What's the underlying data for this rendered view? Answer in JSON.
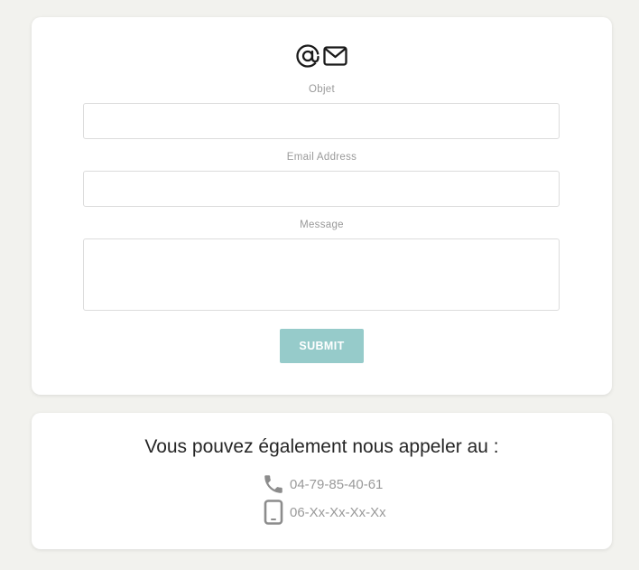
{
  "contact_form": {
    "header_icons": [
      "at-icon",
      "envelope-icon"
    ],
    "subject_label": "Objet",
    "subject_value": "",
    "email_label": "Email Address",
    "email_value": "",
    "message_label": "Message",
    "message_value": "",
    "submit_label": "SUBMIT"
  },
  "call_section": {
    "title": "Vous pouvez également nous appeler au :",
    "phones": [
      {
        "icon": "phone-icon",
        "number": "04-79-85-40-61"
      },
      {
        "icon": "mobile-phone-icon",
        "number": "06-Xx-Xx-Xx-Xx"
      }
    ]
  },
  "colors": {
    "background": "#f2f2ee",
    "card": "#ffffff",
    "submit_button": "#96cbca",
    "label_text": "#9a9a9a",
    "title_text": "#262626",
    "icon_gray": "#8c8c8c"
  }
}
